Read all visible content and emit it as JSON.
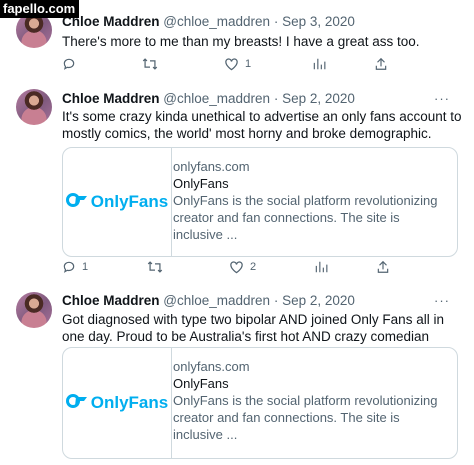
{
  "watermark": "fapello.com",
  "tweets": [
    {
      "name": "Chloe Maddren",
      "handle": "@chloe_maddren",
      "sep": "·",
      "date": "Sep 3, 2020",
      "text": "There's more to me than my breasts! I have a great ass too.",
      "reply_count": "",
      "retweet_count": "",
      "like_count": "1",
      "more": "···"
    },
    {
      "name": "Chloe Maddren",
      "handle": "@chloe_maddren",
      "sep": "·",
      "date": "Sep 2, 2020",
      "text": "It's some crazy kinda unethical to advertise an only fans account to mostly comics, the world' most horny and broke demographic.",
      "card": {
        "logo_text": "OnlyFans",
        "domain": "onlyfans.com",
        "title": "OnlyFans",
        "description": "OnlyFans is the social platform revolutionizing creator and fan connections. The site is inclusive ..."
      },
      "reply_count": "1",
      "retweet_count": "",
      "like_count": "2",
      "more": "···"
    },
    {
      "name": "Chloe Maddren",
      "handle": "@chloe_maddren",
      "sep": "·",
      "date": "Sep 2, 2020",
      "text": "Got diagnosed with type two bipolar AND joined Only Fans all in one day. Proud to be Australia's first hot AND crazy comedian",
      "card": {
        "logo_text": "OnlyFans",
        "domain": "onlyfans.com",
        "title": "OnlyFans",
        "description": "OnlyFans is the social platform revolutionizing creator and fan connections. The site is inclusive ..."
      },
      "more": "···"
    }
  ],
  "icons": [
    "reply-icon",
    "retweet-icon",
    "like-icon",
    "views-icon",
    "share-icon",
    "onlyfans-logo-icon"
  ],
  "colors": {
    "text": "#0f1419",
    "muted": "#536471",
    "border": "#cfd9de",
    "onlyfans_blue": "#00aeef"
  }
}
